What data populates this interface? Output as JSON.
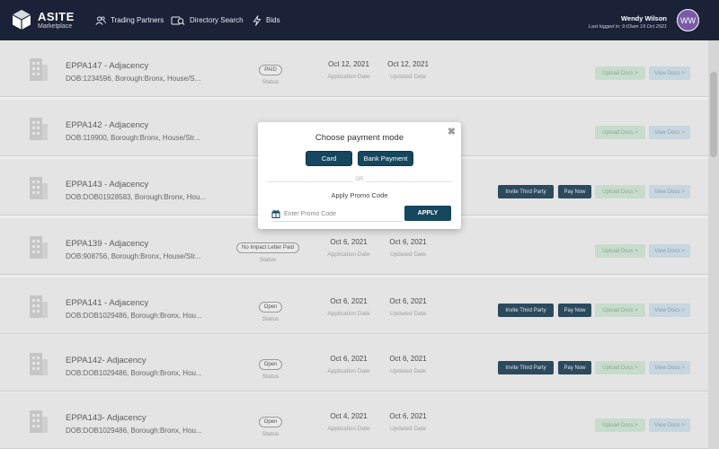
{
  "brand": {
    "title": "ASITE",
    "subtitle": "Marketplace",
    "icon": "cube-logo-icon"
  },
  "nav": [
    {
      "label": "Trading Partners",
      "icon": "users-icon"
    },
    {
      "label": "Directory Search",
      "icon": "directory-search-icon"
    },
    {
      "label": "Bids",
      "icon": "lightning-icon"
    }
  ],
  "user": {
    "name": "Wendy Wilson",
    "last_login": "Last logged in: 9:03am 19 Oct 2021",
    "initials": "WW",
    "avatar_color": "#7a5aa6"
  },
  "labels": {
    "status": "Status",
    "application_date": "Application Date",
    "updated_date": "Updated Date",
    "invite": "Invite Third Party",
    "pay": "Pay Now",
    "upload": "Upload Docs >",
    "view": "View Docs >"
  },
  "rows": [
    {
      "title": "EPPA147 - Adjacency",
      "desc": "DOB:1234596, Borough:Bronx, House/S...",
      "status": "PAID",
      "app_date": "Oct 12, 2021",
      "upd_date": "Oct 12, 2021",
      "actions": false
    },
    {
      "title": "EPPA142 - Adjacency",
      "desc": "DOB:119900, Borough:Bronx, House/Str...",
      "status": "",
      "app_date": "",
      "upd_date": "",
      "actions": false
    },
    {
      "title": "EPPA143 - Adjacency",
      "desc": "DOB:DOB01928583, Borough:Bronx, Hou...",
      "status": "",
      "app_date": "",
      "upd_date": "",
      "actions": true
    },
    {
      "title": "EPPA139 - Adjacency",
      "desc": "DOB:908756, Borough:Bronx, House/Str...",
      "status": "No Impact Letter Paid",
      "app_date": "Oct 6, 2021",
      "upd_date": "Oct 6, 2021",
      "actions": false
    },
    {
      "title": "EPPA141 - Adjacency",
      "desc": "DOB:DOB1029486, Borough:Bronx, Hou...",
      "status": "Open",
      "app_date": "Oct 6, 2021",
      "upd_date": "Oct 6, 2021",
      "actions": true
    },
    {
      "title": "EPPA142- Adjacency",
      "desc": "DOB:DOB1029486, Borough:Bronx, Hou...",
      "status": "Open",
      "app_date": "Oct 6, 2021",
      "upd_date": "Oct 6, 2021",
      "actions": true
    },
    {
      "title": "EPPA143- Adjacency",
      "desc": "DOB:DOB1029486, Borough:Bronx, Hou...",
      "status": "Open",
      "app_date": "Oct 4, 2021",
      "upd_date": "Oct 6, 2021",
      "actions": false
    }
  ],
  "modal": {
    "title": "Choose payment mode",
    "card_label": "Card",
    "bank_label": "Bank Payment",
    "or_text": "OR",
    "promo_label": "Apply Promo Code",
    "promo_placeholder": "Enter Promo Code",
    "promo_value": "",
    "apply_label": "APPLY",
    "close_icon": "close-icon"
  },
  "colors": {
    "topbar": "#1b2238",
    "primary_button": "#15475e",
    "upload_button": "#c8dccd",
    "view_button": "#c7d6df"
  }
}
